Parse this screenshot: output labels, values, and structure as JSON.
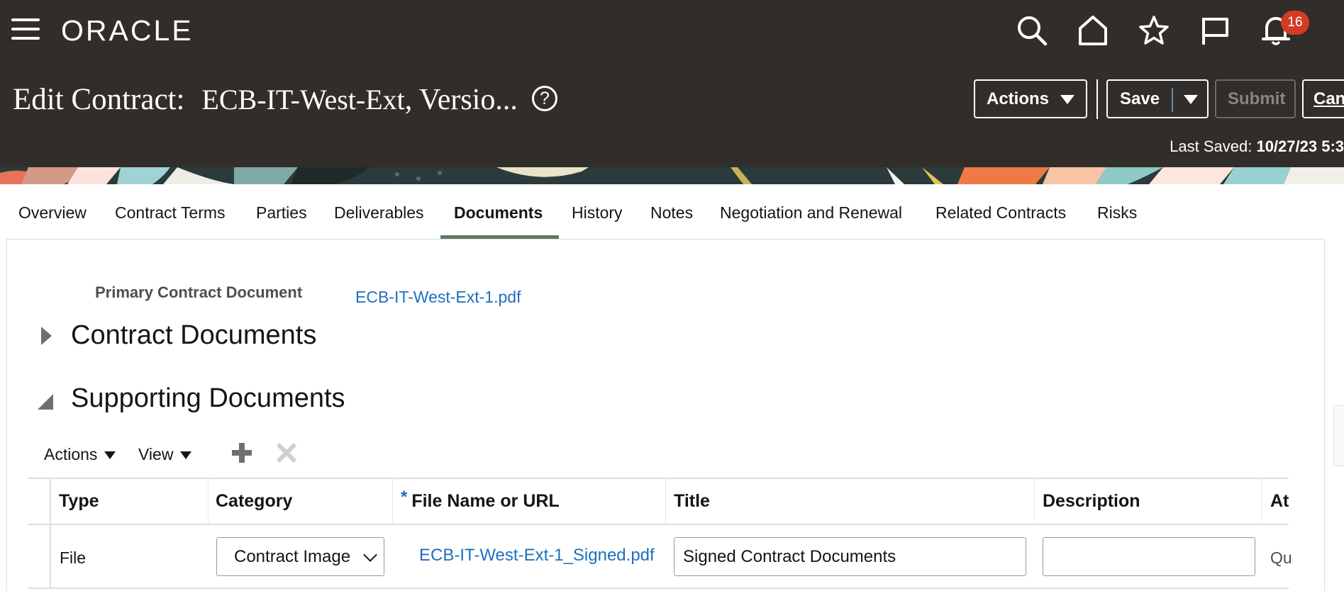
{
  "header": {
    "logo": "ORACLE",
    "notification_count": "16",
    "page_title_label": "Edit Contract:",
    "contract_name": "ECB-IT-West-Ext",
    "version_text": ", Versio...",
    "help_glyph": "?",
    "actions_label": "Actions",
    "save_label": "Save",
    "submit_label": "Submit",
    "cancel_label": "Can",
    "last_saved_label": "Last Saved:",
    "last_saved_value": "10/27/23 5:3"
  },
  "icons": {
    "menu": "hamburger-menu-icon",
    "search": "search-icon",
    "home": "home-icon",
    "favorites": "star-icon",
    "flag": "flag-icon",
    "notifications": "bell-icon"
  },
  "tabs": [
    {
      "label": "Overview"
    },
    {
      "label": "Contract Terms"
    },
    {
      "label": "Parties"
    },
    {
      "label": "Deliverables"
    },
    {
      "label": "Documents",
      "active": true
    },
    {
      "label": "History"
    },
    {
      "label": "Notes"
    },
    {
      "label": "Negotiation and Renewal"
    },
    {
      "label": "Related Contracts"
    },
    {
      "label": "Risks"
    }
  ],
  "documents": {
    "primary_label": "Primary Contract Document",
    "primary_link": "ECB-IT-West-Ext-1.pdf",
    "contract_documents_title": "Contract Documents",
    "supporting_documents_title": "Supporting Documents",
    "toolbar": {
      "actions_label": "Actions",
      "view_label": "View"
    },
    "table": {
      "columns": [
        "Type",
        "Category",
        "File Name or URL",
        "Title",
        "Description",
        "At"
      ],
      "required_marker": "*",
      "rows": [
        {
          "type": "File",
          "category": "Contract Image",
          "file_name": "ECB-IT-West-Ext-1_Signed.pdf",
          "title": "Signed Contract Documents",
          "description": "",
          "attached_by": "Qu"
        }
      ]
    }
  },
  "colors": {
    "header_bg": "#312d2a",
    "link": "#1f6fbf",
    "active_tab_underline": "#5c7c57",
    "badge": "#d43b24"
  }
}
